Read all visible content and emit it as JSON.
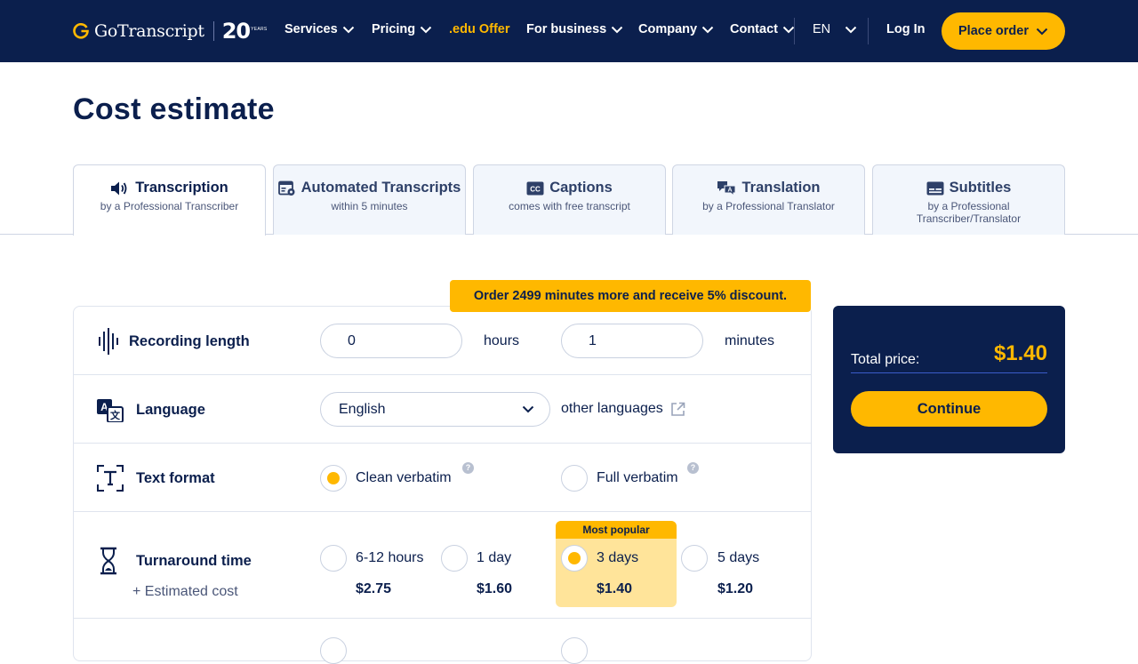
{
  "header": {
    "logo_text": "GoTranscript",
    "logo_badge": "20",
    "logo_badge_sub": "YEARS",
    "nav": [
      {
        "label": "Services"
      },
      {
        "label": "Pricing"
      },
      {
        "label": ".edu Offer"
      },
      {
        "label": "For business"
      },
      {
        "label": "Company"
      },
      {
        "label": "Contact"
      }
    ],
    "language": "EN",
    "login": "Log In",
    "place_order": "Place order"
  },
  "page_title": "Cost estimate",
  "tabs": [
    {
      "title": "Transcription",
      "sub": "by a Professional Transcriber",
      "icon": "speaker-icon"
    },
    {
      "title": "Automated Transcripts",
      "sub": "within 5 minutes",
      "icon": "automated-icon"
    },
    {
      "title": "Captions",
      "sub": "comes with free transcript",
      "icon": "cc-icon"
    },
    {
      "title": "Translation",
      "sub": "by a Professional Translator",
      "icon": "translation-icon"
    },
    {
      "title": "Subtitles",
      "sub": "by a Professional Transcriber/Translator",
      "icon": "subtitles-icon"
    }
  ],
  "discount_banner": "Order 2499 minutes more and receive 5% discount.",
  "form": {
    "recording": {
      "label": "Recording length",
      "hours_value": "0",
      "hours_unit": "hours",
      "minutes_value": "1",
      "minutes_unit": "minutes"
    },
    "language": {
      "label": "Language",
      "selected": "English",
      "other": "other languages"
    },
    "text_format": {
      "label": "Text format",
      "options": [
        {
          "label": "Clean verbatim",
          "checked": true
        },
        {
          "label": "Full verbatim",
          "checked": false
        }
      ],
      "help": "?"
    },
    "turnaround": {
      "label": "Turnaround time",
      "estimated": "+ Estimated cost",
      "popular_badge": "Most popular",
      "options": [
        {
          "label": "6-12 hours",
          "price": "$2.75"
        },
        {
          "label": "1 day",
          "price": "$1.60"
        },
        {
          "label": "3 days",
          "price": "$1.40"
        },
        {
          "label": "5 days",
          "price": "$1.20"
        }
      ]
    }
  },
  "total": {
    "label": "Total price:",
    "value": "$1.40",
    "button": "Continue"
  },
  "colors": {
    "navy": "#0b1f4d",
    "accent": "#ffb800",
    "accent_light": "#ffe49a"
  }
}
